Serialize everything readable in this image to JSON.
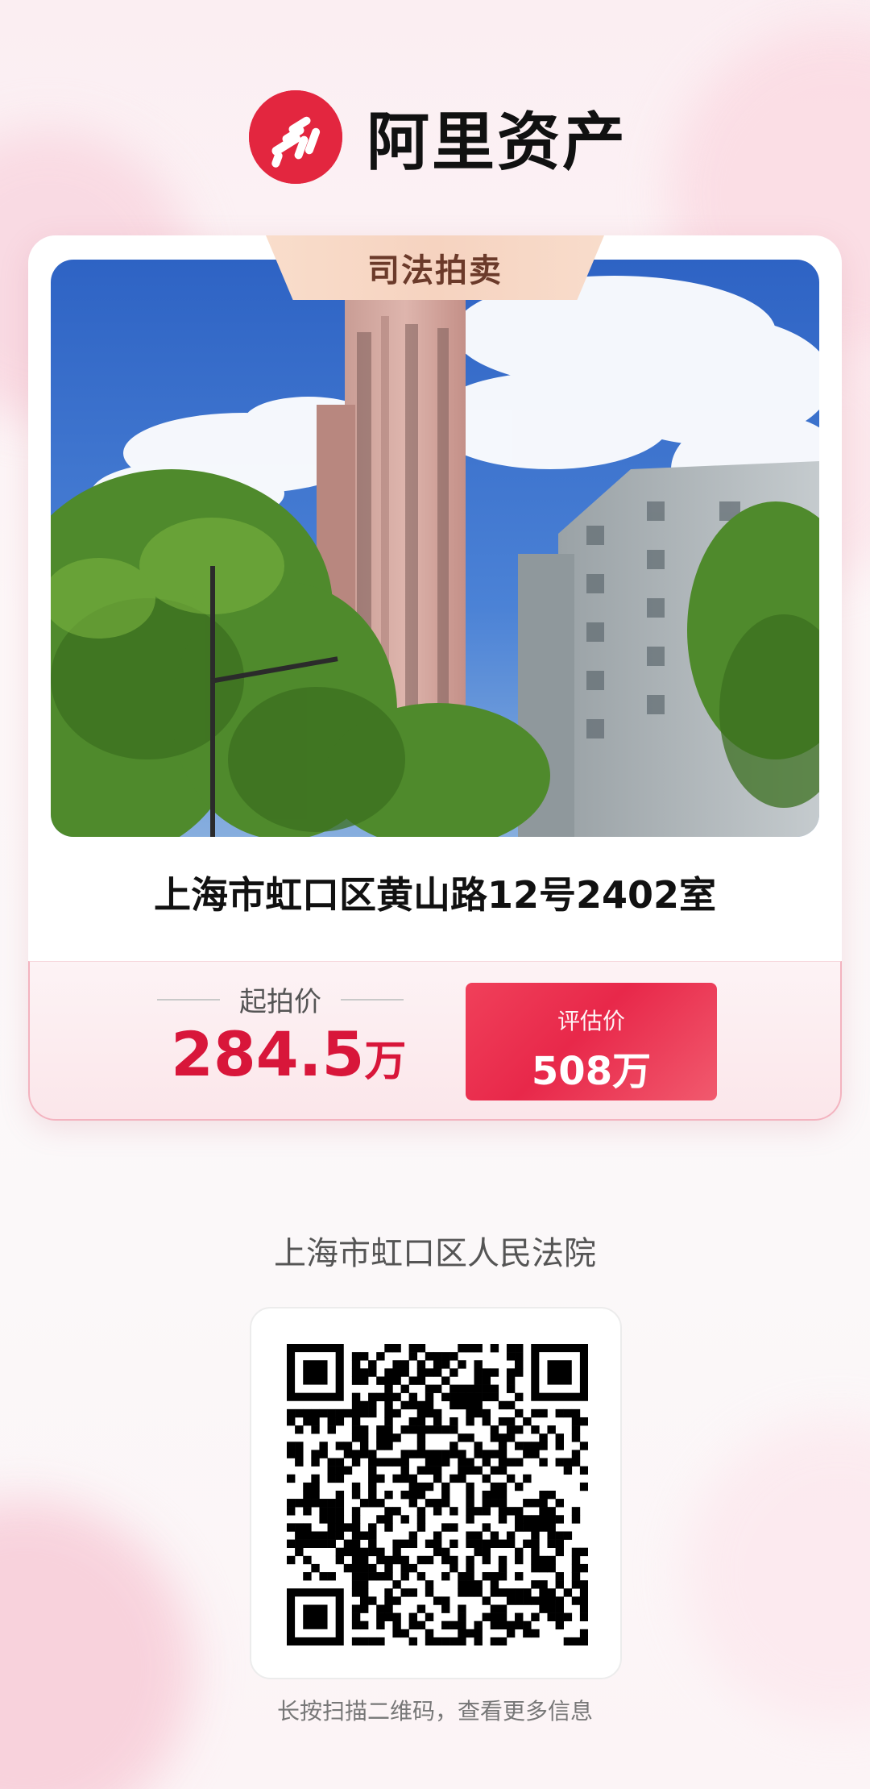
{
  "brand": {
    "name": "阿里资产",
    "logo_color": "#e3263f"
  },
  "listing": {
    "badge": "司法拍卖",
    "address": "上海市虹口区黄山路12号2402室",
    "photo_icon": "building-photo"
  },
  "pricing": {
    "start_label": "起拍价",
    "start_value": "284.5",
    "start_unit": "万",
    "eval_label": "评估价",
    "eval_value": "508万",
    "accent_color": "#d8163a"
  },
  "court": {
    "name": "上海市虹口区人民法院"
  },
  "qr": {
    "icon": "qr-code",
    "hint": "长按扫描二维码，查看更多信息"
  }
}
